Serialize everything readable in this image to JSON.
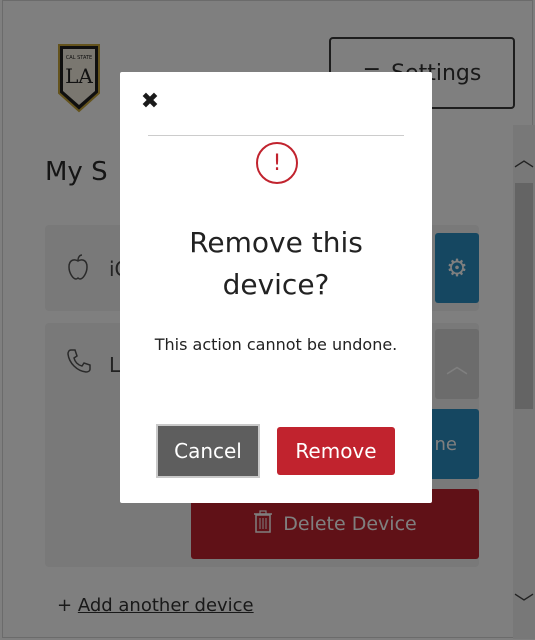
{
  "header": {
    "logo_text": "LA",
    "logo_top_text": "CAL STATE",
    "settings_label": "Settings",
    "settings_icon": "hamburger-icon"
  },
  "section": {
    "title": "My S"
  },
  "devices": [
    {
      "icon": "apple-icon",
      "label": "iC",
      "action_icon": "gear-icon"
    },
    {
      "icon": "phone-icon",
      "label": "L",
      "action_icon": "chevron-up-icon",
      "partial_action_label": "ne",
      "delete_label": "Delete Device"
    }
  ],
  "add_device": {
    "prefix": "+",
    "label": "Add another device"
  },
  "modal": {
    "close_icon": "close-icon",
    "alert_icon": "exclamation-icon",
    "alert_glyph": "!",
    "title": "Remove this device?",
    "message": "This action cannot be undone.",
    "cancel_label": "Cancel",
    "remove_label": "Remove"
  },
  "colors": {
    "primary_blue": "#2a8fc3",
    "danger_red": "#c1232e",
    "cancel_gray": "#5e5e5e"
  }
}
